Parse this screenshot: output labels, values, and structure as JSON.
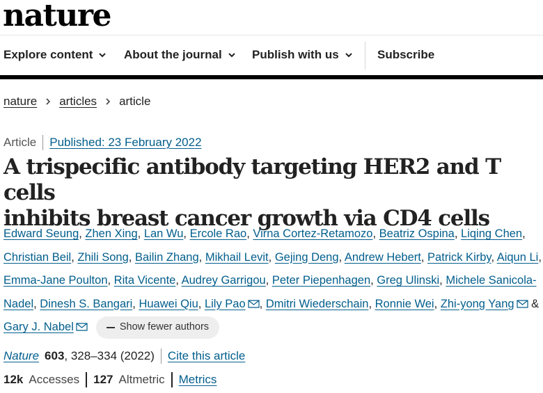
{
  "site": {
    "logo": "nature"
  },
  "nav": {
    "items": [
      {
        "label": "Explore content",
        "has_dropdown": true
      },
      {
        "label": "About the journal",
        "has_dropdown": true
      },
      {
        "label": "Publish with us",
        "has_dropdown": true
      },
      {
        "label": "Subscribe",
        "has_dropdown": false
      }
    ]
  },
  "breadcrumb": {
    "items": [
      "nature",
      "articles"
    ],
    "current": "article"
  },
  "article": {
    "type": "Article",
    "published": "Published: 23 February 2022",
    "title_line1": "A trispecific antibody targeting HER2 and T cells",
    "title_line2": "inhibits breast cancer growth via CD4 cells"
  },
  "authors": {
    "names": [
      "Edward Seung",
      "Zhen Xing",
      "Lan Wu",
      "Ercole Rao",
      "Virna Cortez-Retamozo",
      "Beatriz Ospina",
      "Liqing Chen",
      "Christian Beil",
      "Zhili Song",
      "Bailin Zhang",
      "Mikhail Levit",
      "Gejing Deng",
      "Andrew Hebert",
      "Patrick Kirby",
      "Aiqun Li",
      "Emma-Jane Poulton",
      "Rita Vicente",
      "Audrey Garrigou",
      "Peter Piepenhagen",
      "Greg Ulinski",
      "Michele Sanicola-Nadel",
      "Dinesh S. Bangari",
      "Huawei Qiu",
      "Lily Pao",
      "Dmitri Wiederschain",
      "Ronnie Wei",
      "Zhi-yong Yang",
      "Gary J. Nabel"
    ],
    "corresponding": [
      "Lily Pao",
      "Zhi-yong Yang",
      "Gary J. Nabel"
    ],
    "and_symbol": "&",
    "show_fewer_label": "Show fewer authors"
  },
  "citation": {
    "journal": "Nature",
    "volume": "603",
    "pages_year": ", 328–334 (2022)",
    "cite_label": "Cite this article"
  },
  "metrics": {
    "accesses_value": "12k",
    "accesses_label": "Accesses",
    "altmetric_value": "127",
    "altmetric_label": "Altmetric",
    "metrics_link": "Metrics"
  },
  "colors": {
    "link": "#025e8d",
    "text": "#222222",
    "nav_bar": "#000000",
    "pill_bg": "#eeeeee"
  }
}
